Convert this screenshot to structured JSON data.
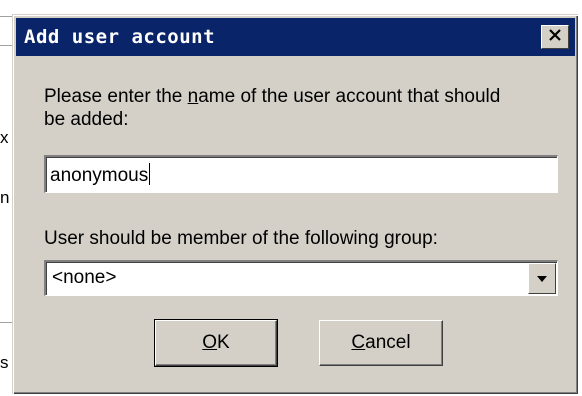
{
  "dialog": {
    "title": "Add user account",
    "name_prompt_line1_pre": "Please enter the ",
    "name_prompt_line1_mnemonic": "n",
    "name_prompt_line1_post": "ame of the user account that should",
    "name_prompt_line2": "be added:",
    "name_value": "anonymous",
    "group_prompt_pre": "User should be member of the following ",
    "group_prompt_mnemonic": "g",
    "group_prompt_post": "roup:",
    "group_value": "<none>",
    "ok_mnemonic": "O",
    "ok_rest": "K",
    "cancel_mnemonic": "C",
    "cancel_rest": "ancel"
  },
  "background": {
    "frag1": "x",
    "frag2": "n",
    "frag3": "s"
  },
  "icons": {
    "close": "close-icon",
    "dropdown": "chevron-down-icon"
  },
  "colors": {
    "titlebar": "#0a246a",
    "face": "#d4d0c8"
  }
}
